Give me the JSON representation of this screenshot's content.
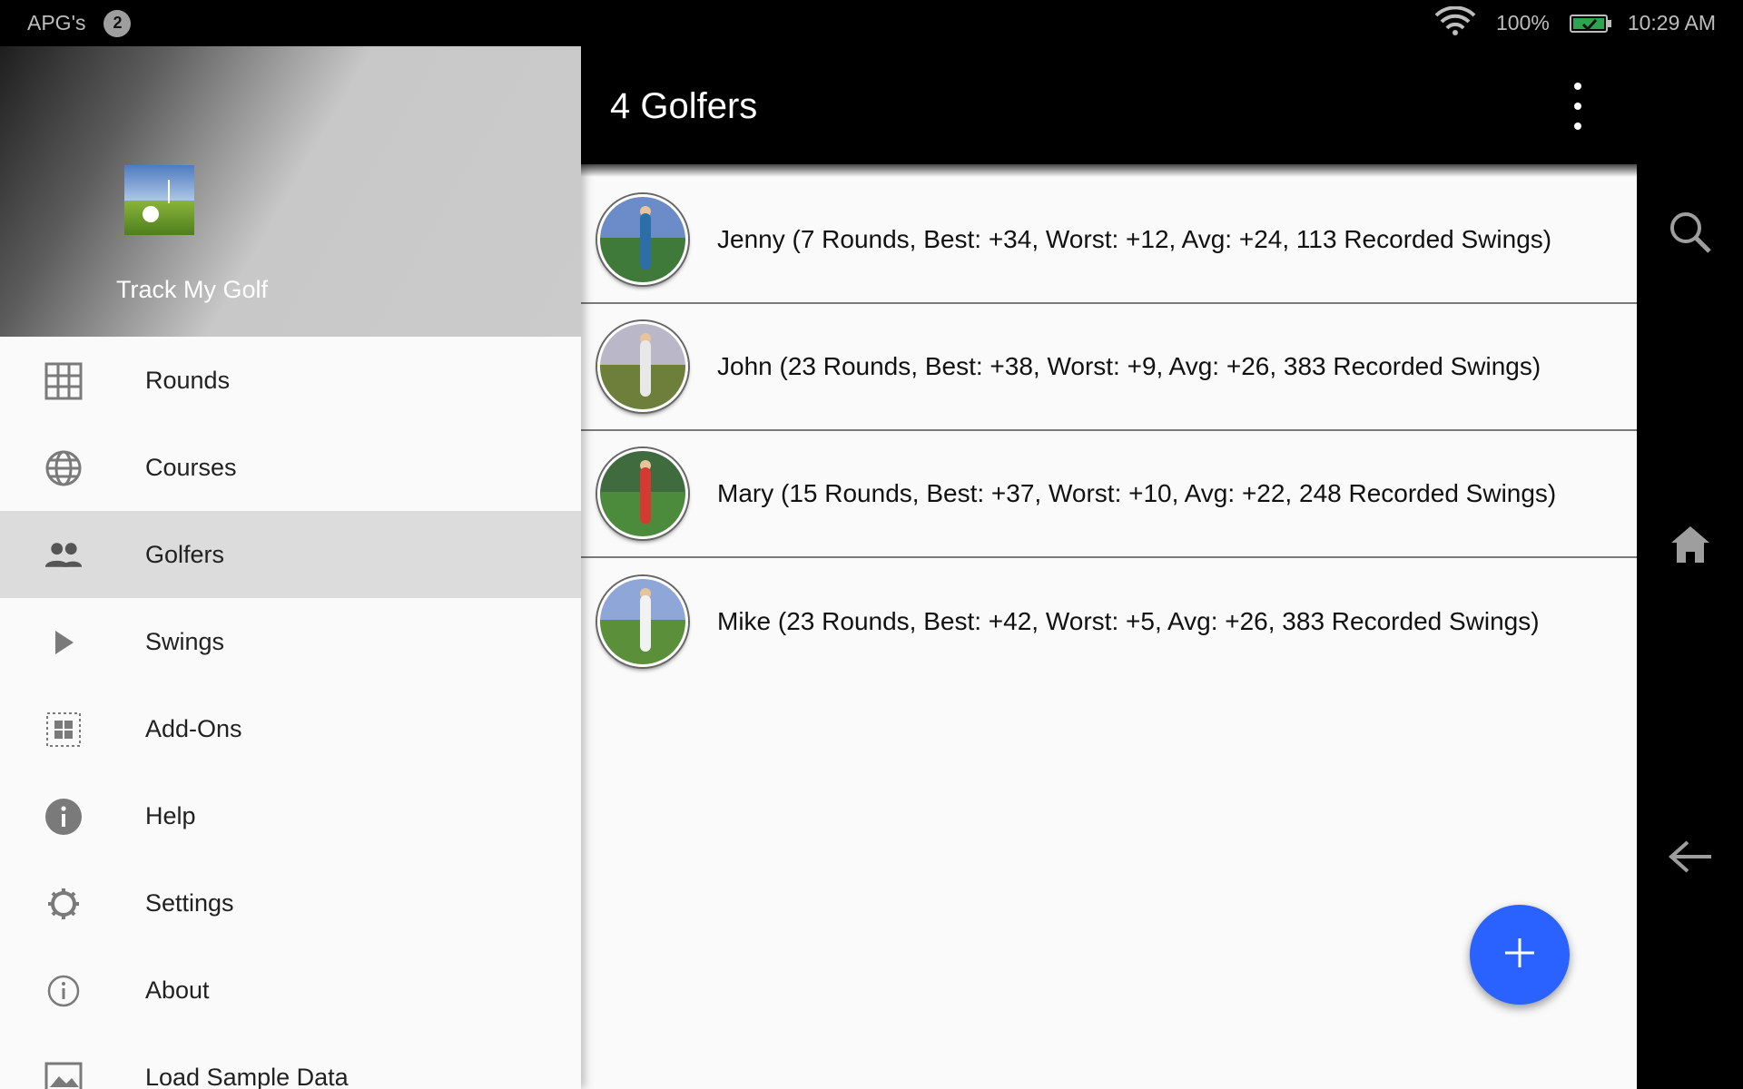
{
  "status_bar": {
    "notification_app": "APG's",
    "notification_count": "2",
    "battery_percent": "100%",
    "time": "10:29 AM",
    "icons": [
      "wifi-icon",
      "battery-charging-icon"
    ]
  },
  "toolbar": {
    "title": "4 Golfers",
    "menu_icon": "overflow-menu-icon"
  },
  "drawer": {
    "app_name": "Track My Golf",
    "items": [
      {
        "label": "Rounds",
        "icon": "grid-icon",
        "active": false
      },
      {
        "label": "Courses",
        "icon": "globe-icon",
        "active": false
      },
      {
        "label": "Golfers",
        "icon": "people-icon",
        "active": true
      },
      {
        "label": "Swings",
        "icon": "play-icon",
        "active": false
      },
      {
        "label": "Add-Ons",
        "icon": "addons-icon",
        "active": false
      },
      {
        "label": "Help",
        "icon": "info-filled-icon",
        "active": false
      },
      {
        "label": "Settings",
        "icon": "gear-icon",
        "active": false
      },
      {
        "label": "About",
        "icon": "info-outline-icon",
        "active": false
      },
      {
        "label": "Load Sample Data",
        "icon": "image-icon",
        "active": false
      }
    ]
  },
  "golfers": [
    {
      "name": "Jenny",
      "details": " (7 Rounds, Best: +34, Worst: +12, Avg: +24, 113 Recorded Swings)",
      "colors": {
        "sky": "#6b8cc9",
        "grass": "#3f7a3a",
        "person": "#2c6fa8"
      }
    },
    {
      "name": "John",
      "details": " (23 Rounds, Best: +38, Worst: +9, Avg: +26, 383 Recorded Swings)",
      "colors": {
        "sky": "#b9b7c8",
        "grass": "#6d7f3a",
        "person": "#e8e8e8"
      }
    },
    {
      "name": "Mary",
      "details": " (15 Rounds, Best: +37, Worst: +10, Avg: +22, 248 Recorded Swings)",
      "colors": {
        "sky": "#3f6b3f",
        "grass": "#4c8a3c",
        "person": "#d43a32"
      }
    },
    {
      "name": "Mike",
      "details": " (23 Rounds, Best: +42, Worst: +5, Avg: +26, 383 Recorded Swings)",
      "colors": {
        "sky": "#8ea6d8",
        "grass": "#5c8f3a",
        "person": "#f2f2f2"
      }
    }
  ],
  "fab": {
    "icon": "plus-icon"
  },
  "nav_bar": {
    "buttons": [
      {
        "icon": "search-icon"
      },
      {
        "icon": "home-icon"
      },
      {
        "icon": "back-arrow-icon"
      }
    ]
  }
}
